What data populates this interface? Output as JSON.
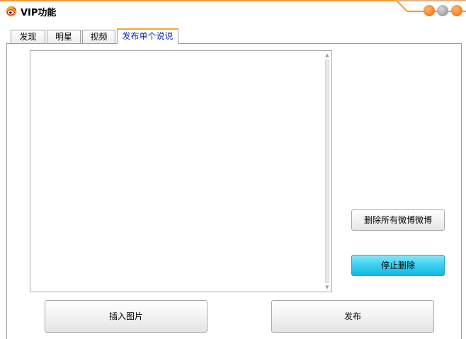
{
  "window": {
    "title": "VIP功能",
    "icon": "weibo-logo-icon",
    "controls": [
      "minimize-button",
      "maximize-button",
      "close-button"
    ],
    "accent_color": "#f39a3a"
  },
  "tabs": [
    {
      "label": "发现",
      "active": false
    },
    {
      "label": "明星",
      "active": false
    },
    {
      "label": "视频",
      "active": false
    },
    {
      "label": "发布单个说说",
      "active": true
    }
  ],
  "editor": {
    "value": ""
  },
  "actions": {
    "delete_all_label": "删除所有微博微博",
    "stop_delete_label": "停止删除",
    "insert_image_label": "插入图片",
    "publish_label": "发布"
  }
}
